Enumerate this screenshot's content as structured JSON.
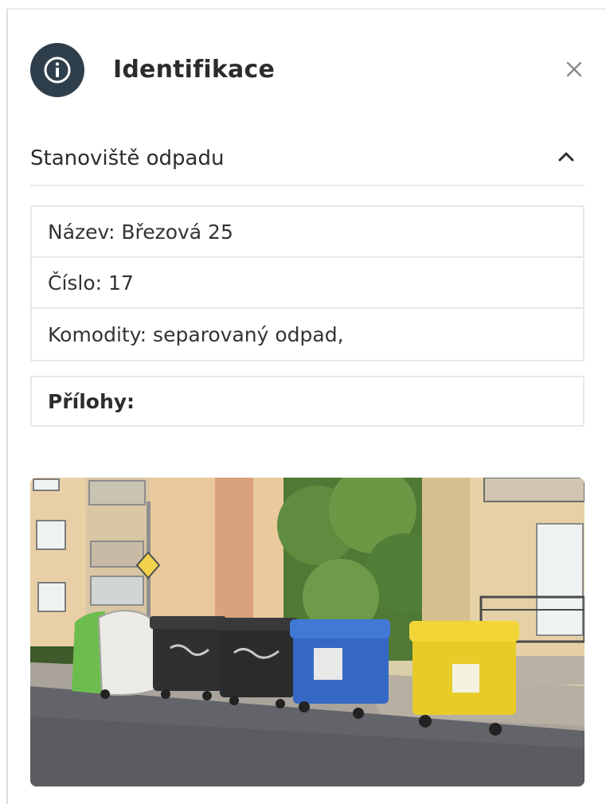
{
  "header": {
    "title": "Identifikace",
    "info_icon": "info-circle-icon",
    "close_icon": "close-icon"
  },
  "section": {
    "title": "Stanoviště odpadu",
    "toggle_icon": "chevron-up-icon",
    "rows": [
      {
        "text": "Název: Březová 25"
      },
      {
        "text": "Číslo: 17"
      },
      {
        "text": "Komodity: separovaný odpad,"
      }
    ]
  },
  "attachments": {
    "label": "Přílohy:"
  },
  "photo": {
    "subject": "waste-containers-photo"
  },
  "colors": {
    "badge_bg": "#2f3e4b",
    "border": "#e8e8e8",
    "text": "#2c2c2c"
  }
}
